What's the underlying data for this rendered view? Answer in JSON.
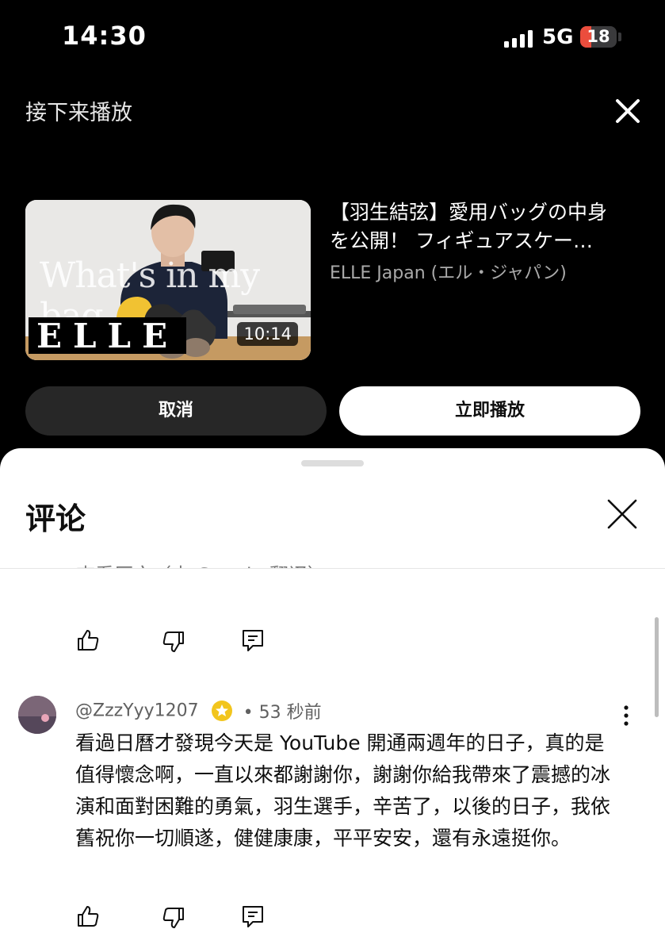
{
  "status_bar": {
    "time": "14:30",
    "network": "5G",
    "battery": "18"
  },
  "up_next": {
    "title": "接下来播放",
    "video": {
      "title_line1": "【羽生結弦】愛用バッグの中身",
      "title_line2": "を公開！ フィギュアスケー…",
      "channel": "ELLE Japan (エル・ジャパン)",
      "duration": "10:14",
      "thumbnail_text": "What's in my bag",
      "thumbnail_logo": "ELLE"
    },
    "cancel_label": "取消",
    "play_label": "立即播放"
  },
  "comments": {
    "title": "评论",
    "truncated_text": "查看原文（由 Google 翻译）",
    "comment": {
      "author": "@ZzzYyy1207",
      "time": "• 53 秒前",
      "text": "看過日曆才發現今天是 YouTube 開通兩週年的日子，真的是值得懷念啊，一直以來都謝謝你，謝謝你給我帶來了震撼的冰演和面對困難的勇氣，羽生選手，辛苦了，以後的日子，我依舊祝你一切順遂，健健康康，平平安安，還有永遠挺你。"
    }
  },
  "colors": {
    "battery_low": "#eb4d3d",
    "badge": "#f2c51d",
    "dark_button": "#272727"
  }
}
